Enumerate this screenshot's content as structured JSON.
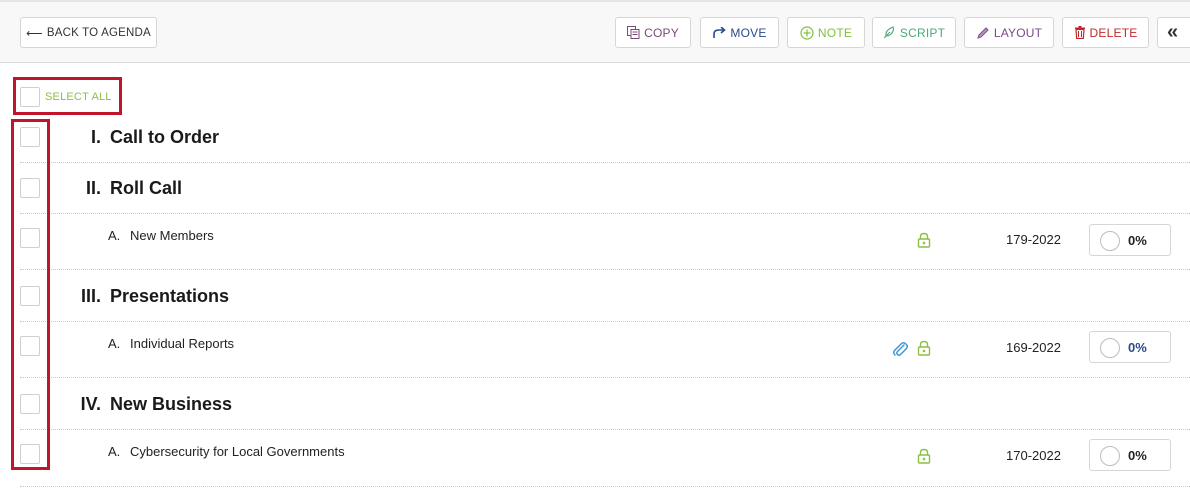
{
  "toolbar": {
    "back_label": "BACK TO AGENDA",
    "copy_label": "COPY",
    "move_label": "MOVE",
    "note_label": "NOTE",
    "script_label": "SCRIPT",
    "layout_label": "LAYOUT",
    "delete_label": "DELETE",
    "collapse_label": "«"
  },
  "select_all": {
    "label": "SELECT ALL"
  },
  "agenda": {
    "sections": [
      {
        "num": "I.",
        "title": "Call to Order"
      },
      {
        "num": "II.",
        "title": "Roll Call"
      },
      {
        "num": "III.",
        "title": "Presentations"
      },
      {
        "num": "IV.",
        "title": "New Business"
      }
    ],
    "items": [
      {
        "letter": "A.",
        "title": "New Members",
        "number": "179-2022",
        "progress": "0%",
        "attachment": false
      },
      {
        "letter": "A.",
        "title": "Individual Reports",
        "number": "169-2022",
        "progress": "0%",
        "attachment": true
      },
      {
        "letter": "A.",
        "title": "Cybersecurity for Local Governments",
        "number": "170-2022",
        "progress": "0%",
        "attachment": false
      }
    ]
  },
  "colors": {
    "highlight": "#c2152d",
    "select_all": "#8cc043",
    "lock": "#8cc043",
    "attachment": "#3a9ad9",
    "delete": "#c0282c"
  }
}
